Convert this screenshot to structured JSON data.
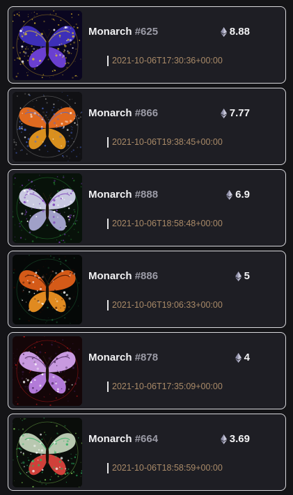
{
  "items": [
    {
      "title": "Monarch",
      "number": "#625",
      "price": "8.88",
      "timestamp": "2021-10-06T17:30:36+00:00",
      "art": {
        "bg": "#0a0620",
        "wing_upper": "#3d2fb8",
        "wing_lower": "#6a3fd0",
        "accent": "#e0c030",
        "ring": "#c8a020"
      }
    },
    {
      "title": "Monarch",
      "number": "#866",
      "price": "7.77",
      "timestamp": "2021-10-06T19:38:45+00:00",
      "art": {
        "bg": "#111114",
        "wing_upper": "#e06a20",
        "wing_lower": "#d9901e",
        "accent": "#4a6bd8",
        "ring": "#8a8a8a"
      }
    },
    {
      "title": "Monarch",
      "number": "#888",
      "price": "6.9",
      "timestamp": "2021-10-06T18:58:48+00:00",
      "art": {
        "bg": "#08120a",
        "wing_upper": "#c8c8e0",
        "wing_lower": "#a0a0c8",
        "accent": "#7a3ab8",
        "ring": "#2a9a3a"
      }
    },
    {
      "title": "Monarch",
      "number": "#886",
      "price": "5",
      "timestamp": "2021-10-06T19:06:33+00:00",
      "art": {
        "bg": "#050807",
        "wing_upper": "#d45a18",
        "wing_lower": "#e08a20",
        "accent": "#2a0a04",
        "ring": "#1f6a3a"
      }
    },
    {
      "title": "Monarch",
      "number": "#878",
      "price": "4",
      "timestamp": "2021-10-06T17:35:09+00:00",
      "art": {
        "bg": "#140608",
        "wing_upper": "#c89ae0",
        "wing_lower": "#b27ad8",
        "accent": "#3a1a4a",
        "ring": "#c81a1a"
      }
    },
    {
      "title": "Monarch",
      "number": "#664",
      "price": "3.69",
      "timestamp": "2021-10-06T18:58:59+00:00",
      "art": {
        "bg": "#0a0d0a",
        "wing_upper": "#b8c8b0",
        "wing_lower": "#d0403a",
        "accent": "#2ab060",
        "ring": "#7ac050"
      }
    }
  ]
}
